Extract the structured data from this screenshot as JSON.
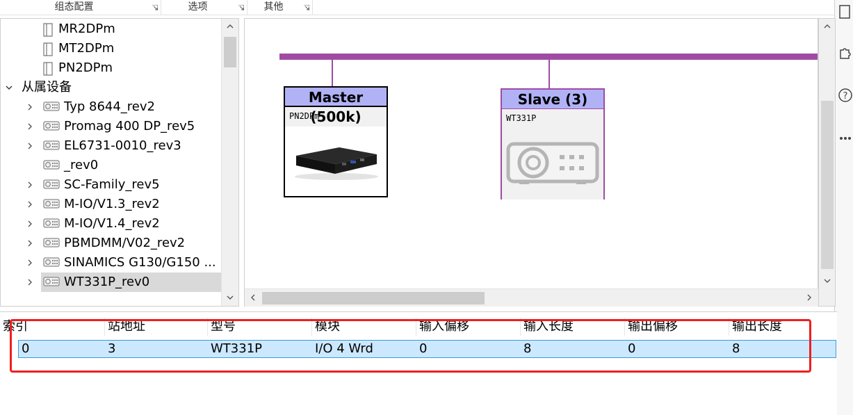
{
  "ribbon": {
    "groups": [
      {
        "label": "组态配置"
      },
      {
        "label": "选项"
      },
      {
        "label": "其他"
      }
    ]
  },
  "tree": {
    "master_items": [
      "MR2DPm",
      "MT2DPm",
      "PN2DPm"
    ],
    "slave_group": "从属设备",
    "slave_items": [
      "Typ 8644_rev2",
      "Promag 400 DP_rev5",
      "EL6731-0010_rev3",
      "_rev0",
      "SC-Family_rev5",
      "M-IO/V1.3_rev2",
      "M-IO/V1.4_rev2",
      "PBMDMM/V02_rev2",
      "SINAMICS G130/G150 ...",
      "WT331P_rev0"
    ],
    "selected": "WT331P_rev0"
  },
  "canvas": {
    "master": {
      "title": "Master (500k)",
      "model": "PN2DPm"
    },
    "slave": {
      "title": "Slave (3)",
      "model": "WT331P"
    },
    "bus_color": "#a04aa4",
    "node_header_color": "#b1b2f6"
  },
  "table": {
    "columns": [
      "索引",
      "站地址",
      "型号",
      "模块",
      "输入偏移",
      "输入长度",
      "输出偏移",
      "输出长度"
    ],
    "rows": [
      [
        "0",
        "3",
        "WT331P",
        "I/O 4 Wrd",
        "0",
        "8",
        "0",
        "8"
      ]
    ]
  },
  "colors": {
    "selection": "#cce8ff",
    "highlight_box": "#f01e1e"
  }
}
